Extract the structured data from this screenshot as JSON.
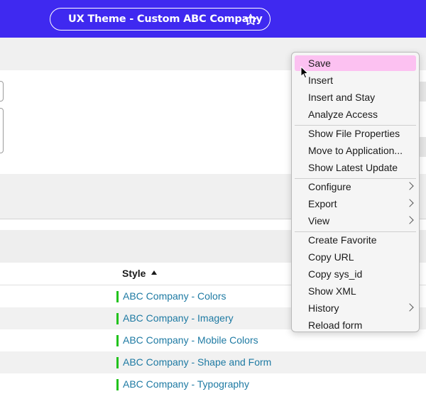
{
  "header": {
    "title": "UX Theme - Custom ABC Company",
    "favorite_icon": "star-outline-icon",
    "background_color": "#3f29f0"
  },
  "table": {
    "columns": [
      {
        "label": "Style",
        "sort": "ascending",
        "sort_icon": "caret-up-icon"
      }
    ],
    "rows": [
      {
        "style": "ABC Company - Colors"
      },
      {
        "style": "ABC Company - Imagery"
      },
      {
        "style": "ABC Company - Mobile Colors"
      },
      {
        "style": "ABC Company - Shape and Form"
      },
      {
        "style": "ABC Company - Typography"
      }
    ],
    "link_color": "#1e7aa3",
    "status_bar_color": "#21c21c"
  },
  "context_menu": {
    "hover_color": "#fcc1f1",
    "groups": [
      [
        {
          "label": "Save",
          "hovered": true
        },
        {
          "label": "Insert"
        },
        {
          "label": "Insert and Stay"
        },
        {
          "label": "Analyze Access"
        }
      ],
      [
        {
          "label": "Show File Properties"
        },
        {
          "label": "Move to Application..."
        },
        {
          "label": "Show Latest Update"
        }
      ],
      [
        {
          "label": "Configure",
          "submenu": true
        },
        {
          "label": "Export",
          "submenu": true
        },
        {
          "label": "View",
          "submenu": true
        }
      ],
      [
        {
          "label": "Create Favorite"
        },
        {
          "label": "Copy URL"
        },
        {
          "label": "Copy sys_id"
        },
        {
          "label": "Show XML"
        },
        {
          "label": "History",
          "submenu": true
        },
        {
          "label": "Reload form"
        }
      ]
    ]
  }
}
